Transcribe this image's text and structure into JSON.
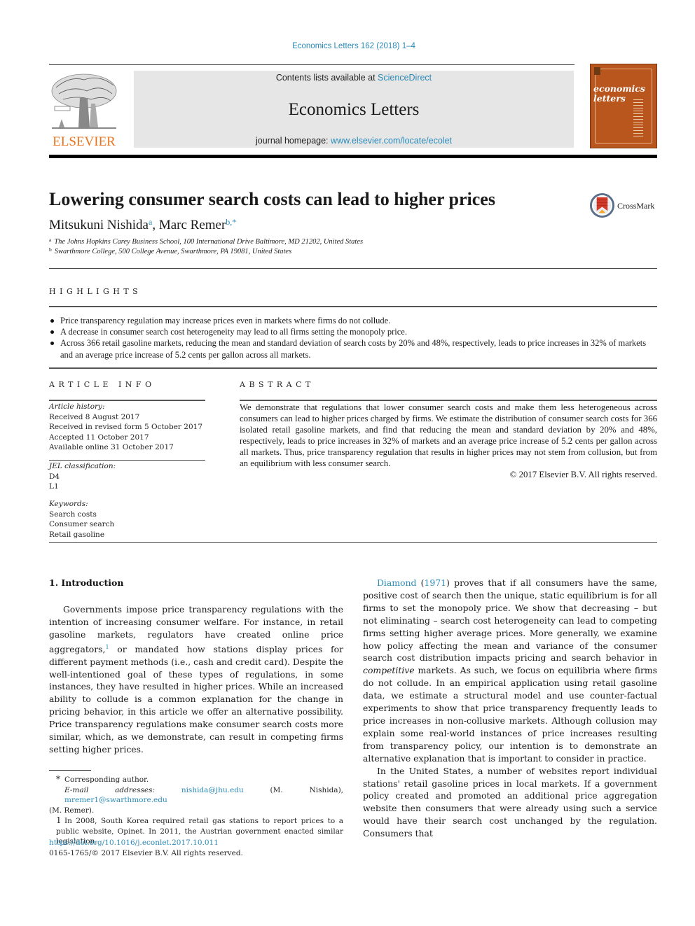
{
  "header": {
    "journal_ref": "Economics Letters 162 (2018) 1–4",
    "contents_prefix": "Contents lists available at ",
    "contents_link": "ScienceDirect",
    "journal_title": "Economics Letters",
    "homepage_prefix": "journal homepage: ",
    "homepage_link": "www.elsevier.com/locate/ecolet",
    "publisher_logo_text": "ELSEVIER",
    "cover_title_line1": "economics",
    "cover_title_line2": "letters",
    "colors": {
      "publisher_orange": "#e8731e",
      "link_blue": "#2a8ab7",
      "cover_brown": "#b8561e",
      "masthead_gray": "#e6e6e6"
    }
  },
  "article": {
    "title": "Lowering consumer search costs can lead to higher prices",
    "crossmark_label": "CrossMark",
    "authors": [
      {
        "name": "Mitsukuni Nishida",
        "sup": "a"
      },
      {
        "name": "Marc Remer",
        "sup": "b,*"
      }
    ],
    "author_separator": ", ",
    "affiliations": [
      {
        "mark": "a",
        "text": "The Johns Hopkins Carey Business School, 100 International Drive Baltimore, MD 21202, United States"
      },
      {
        "mark": "b",
        "text": "Swarthmore College, 500 College Avenue, Swarthmore, PA 19081, United States"
      }
    ]
  },
  "highlights": {
    "heading": "HIGHLIGHTS",
    "items": [
      "Price transparency regulation may increase prices even in markets where firms do not collude.",
      "A decrease in consumer search cost heterogeneity may lead to all firms setting the monopoly price.",
      "Across 366 retail gasoline markets, reducing the mean and standard deviation of search costs by 20% and 48%, respectively, leads to price increases in 32% of markets and an average price increase of 5.2 cents per gallon across all markets."
    ]
  },
  "article_info": {
    "heading": "ARTICLE INFO",
    "history_label": "Article history:",
    "history": [
      "Received 8 August 2017",
      "Received in revised form 5 October 2017",
      "Accepted 11 October 2017",
      "Available online 31 October 2017"
    ],
    "jel_label": "JEL classification:",
    "jel": [
      "D4",
      "L1"
    ],
    "keywords_label": "Keywords:",
    "keywords": [
      "Search costs",
      "Consumer search",
      "Retail gasoline"
    ]
  },
  "abstract": {
    "heading": "ABSTRACT",
    "text": "We demonstrate that regulations that lower consumer search costs and make them less heterogeneous across consumers can lead to higher prices charged by firms. We estimate the distribution of consumer search costs for 366 isolated retail gasoline markets, and find that reducing the mean and standard deviation by 20% and 48%, respectively, leads to price increases in 32% of markets and an average price increase of 5.2 cents per gallon across all markets. Thus, price transparency regulation that results in higher prices may not stem from collusion, but from an equilibrium with less consumer search.",
    "copyright": "© 2017 Elsevier B.V. All rights reserved."
  },
  "body": {
    "section_heading": "1.  Introduction",
    "left_p1_a": "Governments impose price transparency regulations with the intention of increasing consumer welfare. For instance, in retail gasoline markets, regulators have created online price aggregators,",
    "left_p1_fn": "1",
    "left_p1_b": " or mandated how stations display prices for different payment methods (i.e., cash and credit card). Despite the well-intentioned goal of these types of regulations, in some instances, they have resulted in higher prices. While an increased ability to collude is a common explanation for the change in pricing behavior, in this article we offer an alternative possibility. Price transparency regulations make consumer search costs more similar, which, as we demonstrate, can result in competing firms setting higher prices.",
    "right_p1_cite": "Diamond",
    "right_p1_year_open": " (",
    "right_p1_year": "1971",
    "right_p1_year_close": ")",
    "right_p1_a": " proves that if all consumers have the same, positive cost of search then the unique, static equilibrium is for all firms to set the monopoly price. We show that decreasing – but not eliminating – search cost heterogeneity can lead to competing firms setting higher average prices. More generally, we examine how policy affecting the mean and variance of the consumer search cost distribution impacts pricing and search behavior in ",
    "right_p1_em": "competitive",
    "right_p1_b": " markets. As such, we focus on equilibria where firms do not collude. In an empirical application using retail gasoline data, we estimate a structural model and use counter-factual experiments to show that price transparency frequently leads to price increases in non-collusive markets. Although collusion may explain some real-world instances of price increases resulting from transparency policy, our intention is to demonstrate an alternative explanation that is important to consider in practice.",
    "right_p2": "In the United States, a number of websites report individual stations' retail gasoline prices in local markets. If a government policy created and promoted an additional price aggregation website then consumers that were already using such a service would have their search cost unchanged by the regulation. Consumers that"
  },
  "footnotes": {
    "corr_mark": "*",
    "corr_text": "Corresponding author.",
    "email_label": "E-mail addresses:",
    "email1": "nishida@jhu.edu",
    "email1_owner": " (M. Nishida), ",
    "email2": "mremer1@swarthmore.edu",
    "email2_owner": "(M. Remer).",
    "fn1_mark": "1",
    "fn1_text": "In 2008, South Korea required retail gas stations to report prices to a public website, Opinet. In 2011, the Austrian government enacted similar legislation."
  },
  "footer": {
    "doi": "https://doi.org/10.1016/j.econlet.2017.10.011",
    "issn_copyright": "0165-1765/© 2017 Elsevier B.V. All rights reserved."
  }
}
